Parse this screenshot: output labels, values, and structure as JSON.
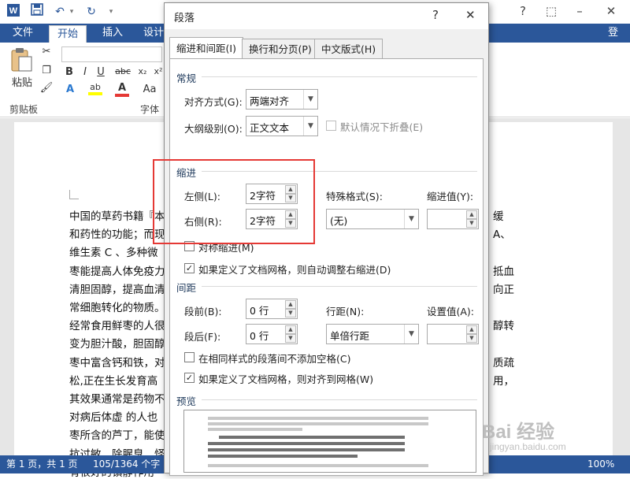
{
  "word": {
    "titlebar": {
      "save_icon": "save-icon",
      "undo_icon": "undo-icon",
      "redo_icon": "redo-icon",
      "controls": [
        "?",
        "–",
        "□",
        "✕"
      ]
    },
    "ribbon": {
      "tabs": [
        "文件",
        "开始",
        "插入",
        "设计"
      ],
      "active_tab": "开始",
      "login": "登录",
      "paste_label": "粘贴",
      "clipboard_group": "剪贴板",
      "font_group": "字体",
      "format_buttons": [
        "B",
        "I",
        "U",
        "abc",
        "x₂",
        "x²"
      ]
    },
    "document": {
      "lines": [
        "中国的草药书籍『本",
        "和药性的功能；而现",
        "维生素 C 、多种微",
        "枣能提高人体免疫力",
        "清胆固醇，提高血清",
        "常细胞转化的物质。",
        "经常食用鲜枣的人很",
        "变为胆汁酸，胆固醇",
        "枣中富含钙和铁，对",
        "松,正在生长发育高",
        "其效果通常是药物不",
        "对病后体虚 的人也",
        "枣所含的芦丁，能使",
        "抗过敏、除腥臭、怪",
        "有很好的镇静作用"
      ],
      "right_lines": [
        "缓",
        "A、",
        "",
        "抵血",
        "向正",
        "",
        "醇转",
        "",
        "质疏",
        "用，",
        "",
        "",
        "",
        "",
        ""
      ]
    },
    "statusbar": {
      "page": "第 1 页，共 1 页",
      "words": "105/1364 个字",
      "zoom": "100%"
    }
  },
  "dialog": {
    "title": "段落",
    "help": "?",
    "close": "✕",
    "tabs": [
      "缩进和间距(I)",
      "换行和分页(P)",
      "中文版式(H)"
    ],
    "general": {
      "title": "常规",
      "alignment_label": "对齐方式(G):",
      "alignment_value": "两端对齐",
      "outline_label": "大纲级别(O):",
      "outline_value": "正文文本",
      "collapse_label": "默认情况下折叠(E)"
    },
    "indent": {
      "title": "缩进",
      "left_label": "左侧(L):",
      "left_value": "2字符",
      "right_label": "右侧(R):",
      "right_value": "2字符",
      "special_label": "特殊格式(S):",
      "special_value": "(无)",
      "by_label": "缩进值(Y):",
      "by_value": "",
      "mirror_label": "对称缩进(M)",
      "mirror_checked": false,
      "grid_label": "如果定义了文档网格，则自动调整右缩进(D)",
      "grid_checked": true
    },
    "spacing": {
      "title": "间距",
      "before_label": "段前(B):",
      "before_value": "0 行",
      "after_label": "段后(F):",
      "after_value": "0 行",
      "line_label": "行距(N):",
      "line_value": "单倍行距",
      "at_label": "设置值(A):",
      "at_value": "",
      "nospace_label": "在相同样式的段落间不添加空格(C)",
      "nospace_checked": false,
      "snap_label": "如果定义了文档网格，则对齐到网格(W)",
      "snap_checked": true
    },
    "preview": {
      "title": "预览"
    }
  },
  "watermark": {
    "text": "Bai 经验",
    "sub": "jingyan.baidu.com"
  },
  "colors": {
    "word_blue": "#2b579a",
    "highlight_red": "#e53935"
  }
}
